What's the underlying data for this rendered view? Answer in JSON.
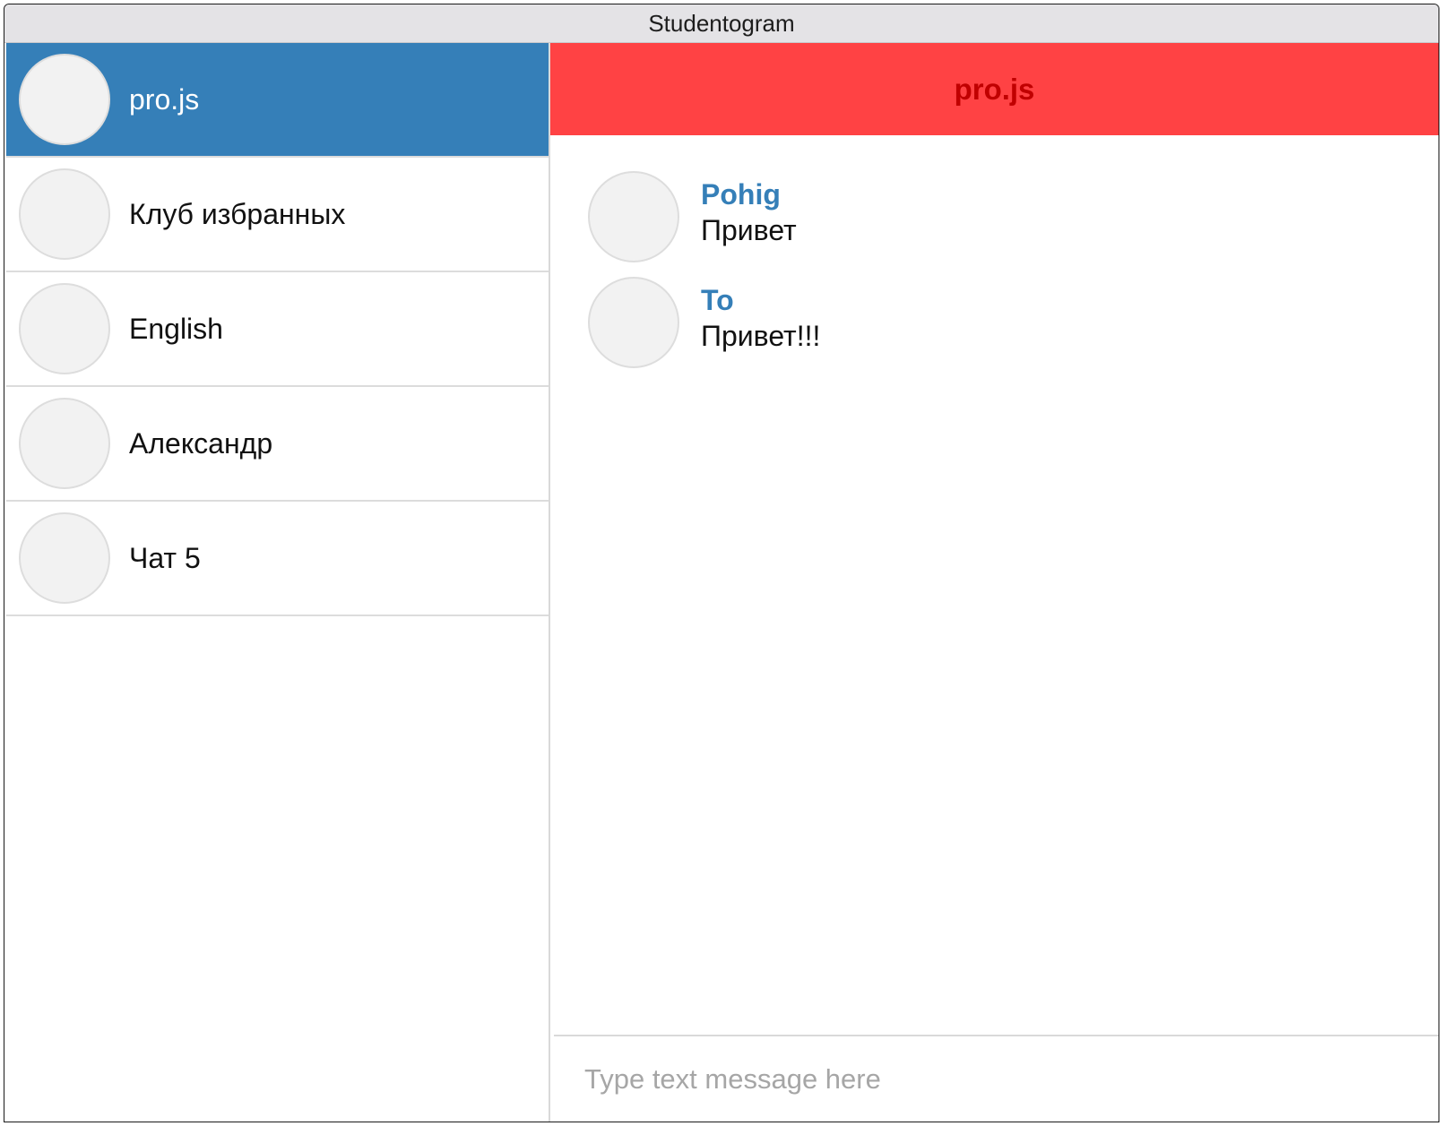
{
  "window": {
    "title": "Studentogram"
  },
  "sidebar": {
    "items": [
      {
        "label": "pro.js",
        "active": true
      },
      {
        "label": "Клуб избранных",
        "active": false
      },
      {
        "label": "English",
        "active": false
      },
      {
        "label": "Александр",
        "active": false
      },
      {
        "label": "Чат 5",
        "active": false
      }
    ]
  },
  "chat": {
    "title": "pro.js",
    "messages": [
      {
        "author": "Pohig",
        "text": "Привет"
      },
      {
        "author": "To",
        "text": "Привет!!!"
      }
    ]
  },
  "composer": {
    "placeholder": "Type text message here"
  },
  "colors": {
    "sidebar_active": "#357fb8",
    "header_bg": "#ff4244",
    "header_text": "#c00000",
    "author": "#357fb8"
  }
}
